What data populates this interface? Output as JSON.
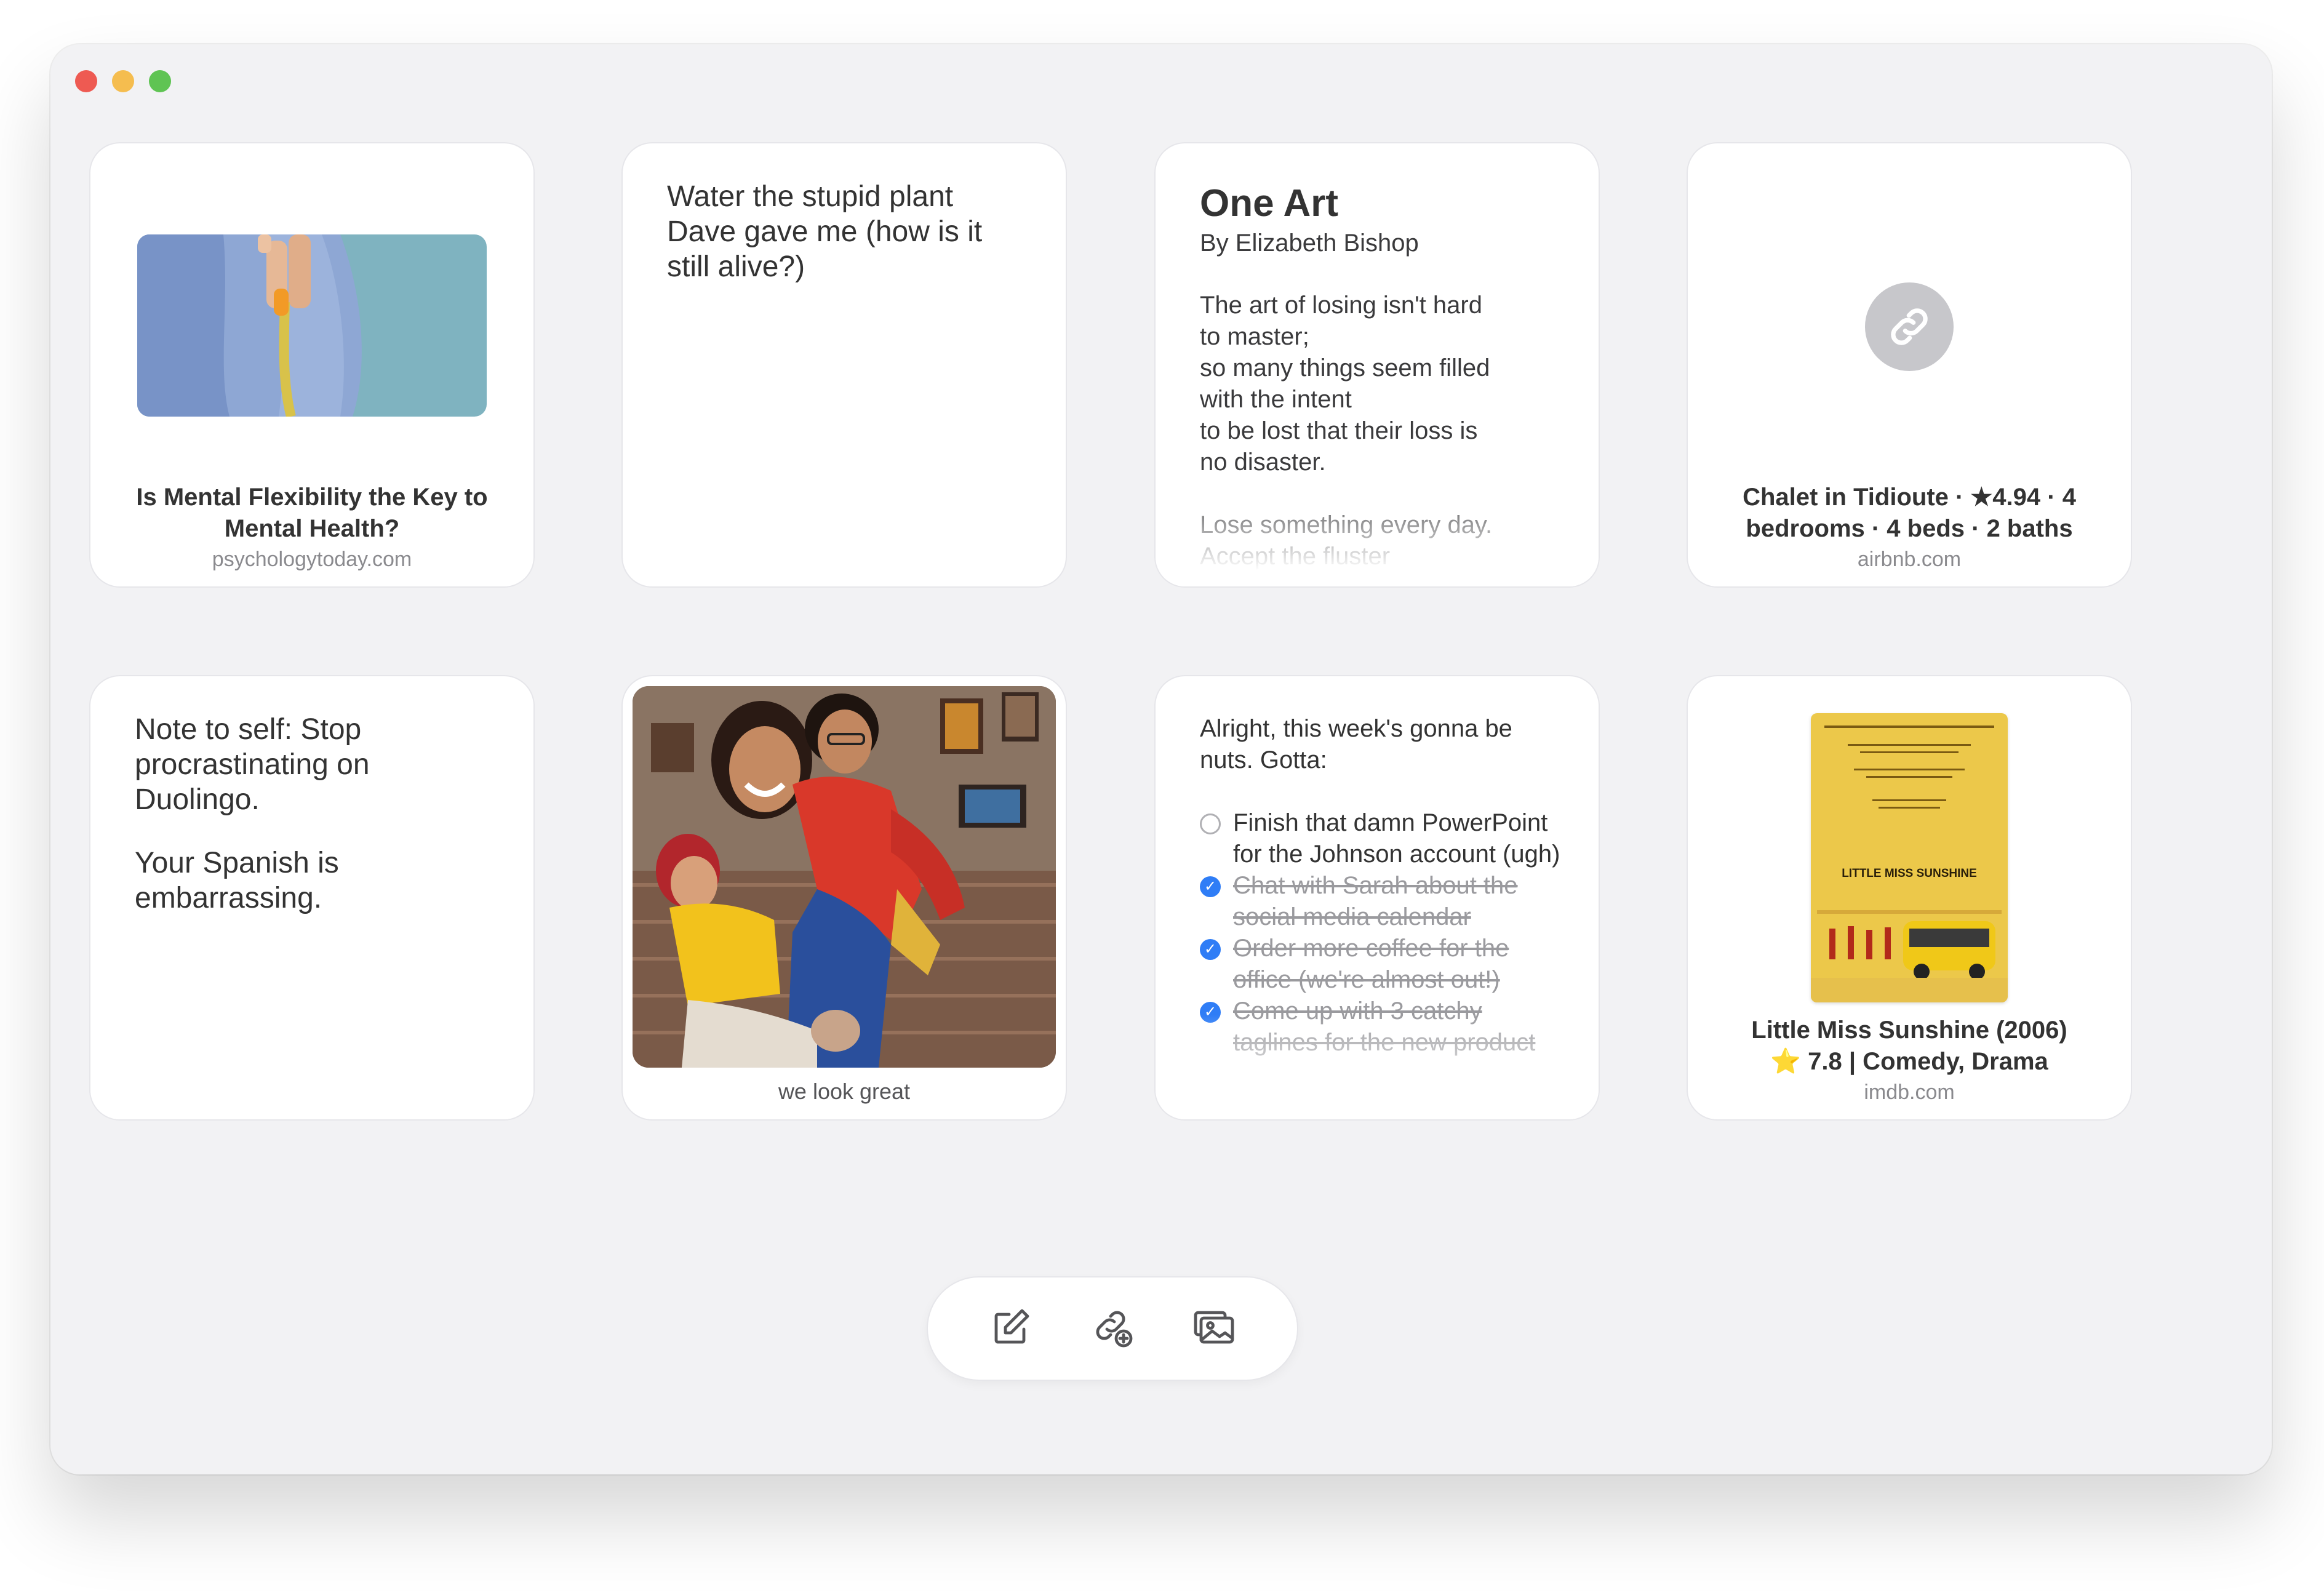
{
  "cards": {
    "article": {
      "title": "Is Mental Flexibility the Key to Mental Health?",
      "domain": "psychologytoday.com"
    },
    "plant_note": {
      "text": "Water the stupid plant Dave gave me (how is it still alive?)"
    },
    "poem": {
      "title": "One Art",
      "author": "By Elizabeth Bishop",
      "lines": [
        "The art of losing isn't hard",
        "to master;",
        "so many things seem filled",
        "with the intent",
        "to be lost that their loss is",
        "no disaster.",
        "",
        "Lose something every day.",
        "Accept the fluster"
      ]
    },
    "airbnb": {
      "title": "Chalet in Tidioute · ★4.94 · 4 bedrooms · 4 beds · 2 baths",
      "domain": "airbnb.com",
      "icon": "link-icon"
    },
    "duolingo_note": {
      "paragraph1": "Note to self: Stop procrastinating on Duolingo.",
      "paragraph2": "Your Spanish is embarrassing."
    },
    "photo": {
      "caption": "we look great"
    },
    "todo": {
      "intro": "Alright, this week's gonna be nuts. Gotta:",
      "tasks": [
        {
          "text": "Finish that damn PowerPoint for the Johnson account (ugh)",
          "done": false
        },
        {
          "text": "Chat with Sarah about the social media calendar",
          "done": true
        },
        {
          "text": "Order more coffee for the office (we're almost out!)",
          "done": true
        },
        {
          "text": "Come up with 3 catchy taglines for the new product",
          "done": true
        }
      ]
    },
    "movie": {
      "title": "Little Miss Sunshine (2006)",
      "rating": "⭐️ 7.8 | Comedy, Drama",
      "domain": "imdb.com",
      "poster_title": "LITTLE MISS SUNSHINE"
    }
  },
  "toolbar": {
    "buttons": [
      {
        "icon": "compose-note-icon"
      },
      {
        "icon": "add-link-icon"
      },
      {
        "icon": "add-photo-icon"
      }
    ]
  },
  "colors": {
    "window_bg": "#f2f2f4",
    "accent": "#2f7df6",
    "close": "#ee5a52",
    "minimize": "#f5bd4f",
    "zoom": "#5fc453"
  }
}
